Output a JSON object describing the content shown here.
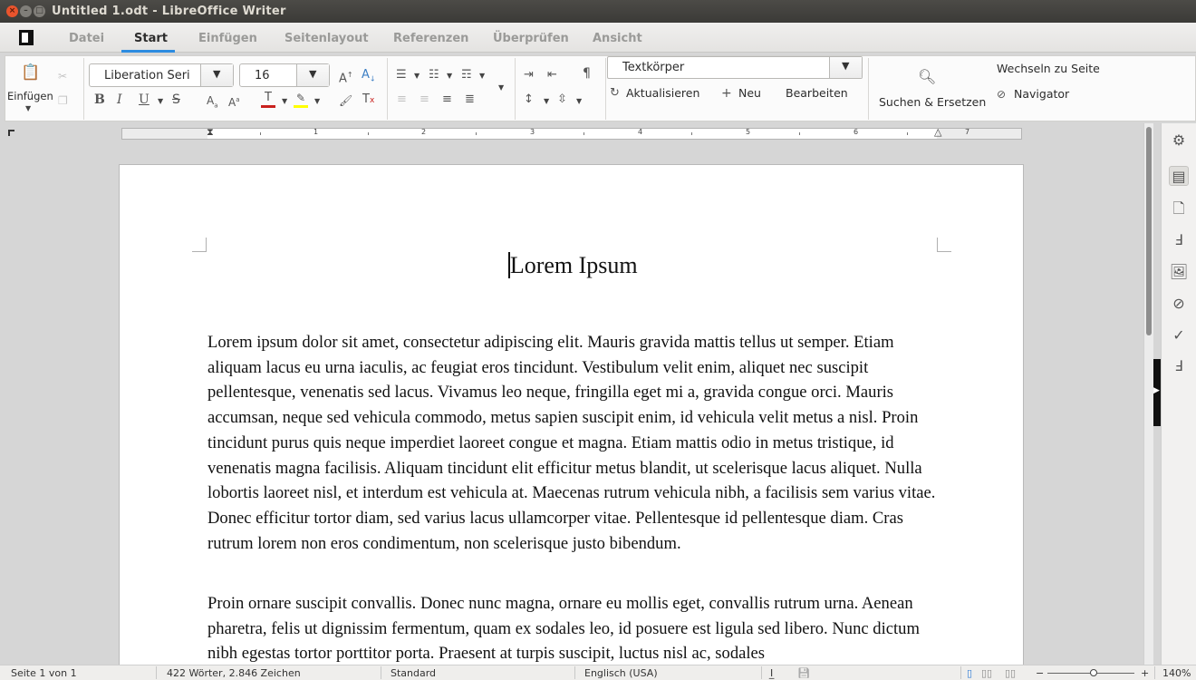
{
  "window": {
    "title": "Untitled 1.odt - LibreOffice Writer",
    "close": "×",
    "minimize": "–",
    "maximize": "□"
  },
  "tabs": [
    {
      "label": "Datei"
    },
    {
      "label": "Start"
    },
    {
      "label": "Einfügen"
    },
    {
      "label": "Seitenlayout"
    },
    {
      "label": "Referenzen"
    },
    {
      "label": "Überprüfen"
    },
    {
      "label": "Ansicht"
    }
  ],
  "active_tab": "Start",
  "toolbar": {
    "paste_label": "Einfügen",
    "font_name": "Liberation Seri",
    "font_size": "16",
    "paragraph_style": "Textkörper",
    "update_label": "Aktualisieren",
    "new_label": "Neu",
    "edit_label": "Bearbeiten",
    "find_replace_label": "Suchen & Ersetzen",
    "goto_page_label": "Wechseln zu Seite",
    "navigator_label": "Navigator",
    "bold": "B",
    "italic": "I",
    "underline": "U",
    "strike": "S",
    "pilcrow": "¶"
  },
  "ruler": {
    "numbers": [
      "1",
      "1",
      "2",
      "3",
      "4",
      "5",
      "6",
      "7"
    ]
  },
  "document": {
    "heading": "Lorem Ipsum",
    "paragraphs": [
      "Lorem ipsum dolor sit amet, consectetur adipiscing elit. Mauris gravida mattis tellus ut semper. Etiam aliquam lacus eu urna iaculis, ac feugiat eros tincidunt. Vestibulum velit enim, aliquet nec suscipit pellentesque, venenatis sed lacus. Vivamus leo neque, fringilla eget mi a, gravida congue orci. Mauris accumsan, neque sed vehicula commodo, metus sapien suscipit enim, id vehicula velit metus a nisl. Proin tincidunt purus quis neque imperdiet laoreet congue et magna. Etiam mattis odio in metus tristique, id venenatis magna facilisis. Aliquam tincidunt elit efficitur metus blandit, ut scelerisque lacus aliquet. Nulla lobortis laoreet nisl, et interdum est vehicula at. Maecenas rutrum vehicula nibh, a facilisis sem varius vitae. Donec efficitur tortor diam, sed varius lacus ullamcorper vitae. Pellentesque id pellentesque diam. Cras rutrum lorem non eros condimentum, non scelerisque justo bibendum.",
      "Proin ornare suscipit convallis. Donec nunc magna, ornare eu mollis eget, convallis rutrum urna. Aenean pharetra, felis ut dignissim fermentum, quam ex sodales leo, id posuere est ligula sed libero. Nunc dictum nibh egestas tortor porttitor porta. Praesent at turpis suscipit, luctus nisl ac, sodales"
    ]
  },
  "statusbar": {
    "page": "Seite 1 von 1",
    "words": "422 Wörter, 2.846 Zeichen",
    "page_style": "Standard",
    "language": "Englisch (USA)",
    "zoom": "140%",
    "zoom_minus": "−",
    "zoom_plus": "+"
  }
}
